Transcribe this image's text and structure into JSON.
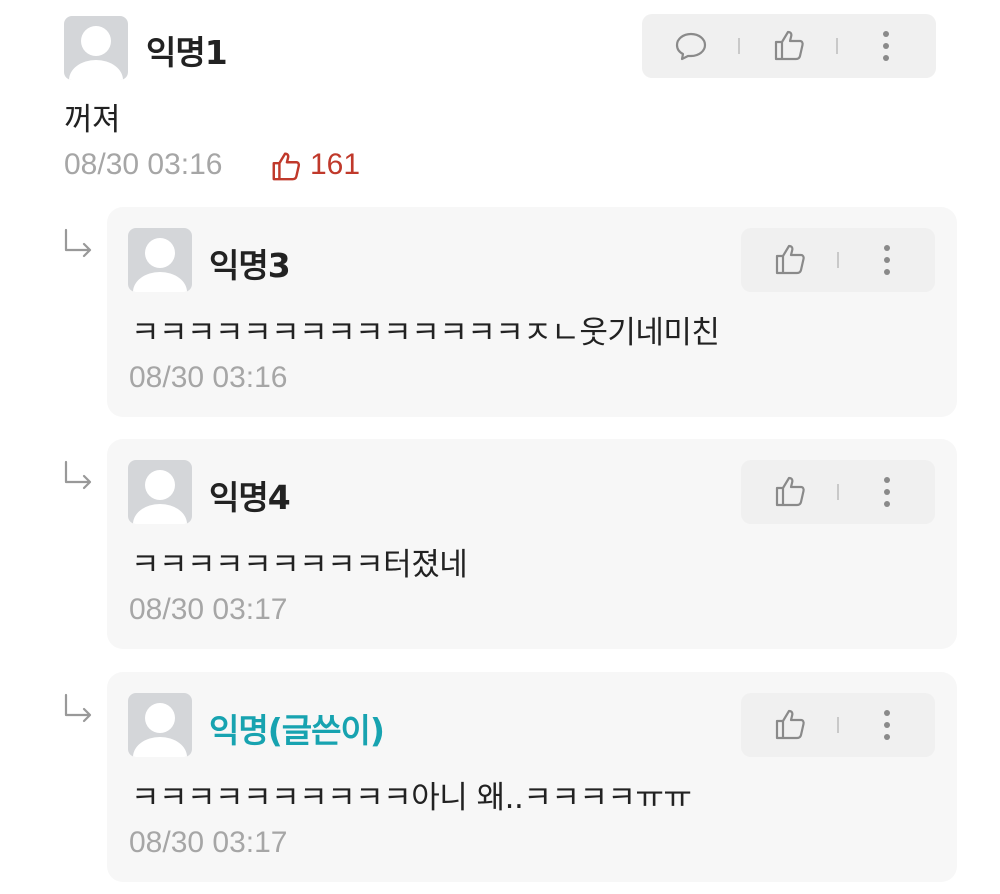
{
  "comment": {
    "author": "익명1",
    "text": "꺼져",
    "time": "08/30 03:16",
    "likes": "161"
  },
  "replies": [
    {
      "author": "익명3",
      "text": "ㅋㅋㅋㅋㅋㅋㅋㅋㅋㅋㅋㅋㅋㅋㅈㄴ웃기네미친",
      "time": "08/30 03:16",
      "is_op": false
    },
    {
      "author": "익명4",
      "text": "ㅋㅋㅋㅋㅋㅋㅋㅋㅋ터졌네",
      "time": "08/30 03:17",
      "is_op": false
    },
    {
      "author": "익명(글쓴이)",
      "text": "ㅋㅋㅋㅋㅋㅋㅋㅋㅋㅋ아니 왜..ㅋㅋㅋㅋㅠㅠ",
      "time": "08/30 03:17",
      "is_op": true
    }
  ],
  "icons": {
    "reply": "speech-bubble-icon",
    "like": "thumbs-up-icon",
    "more": "vertical-dots-icon",
    "reply_arrow": "reply-arrow-icon"
  },
  "colors": {
    "op_name": "#17a3b0",
    "like_count": "#c0392b",
    "timestamp": "#a6a6a6"
  }
}
